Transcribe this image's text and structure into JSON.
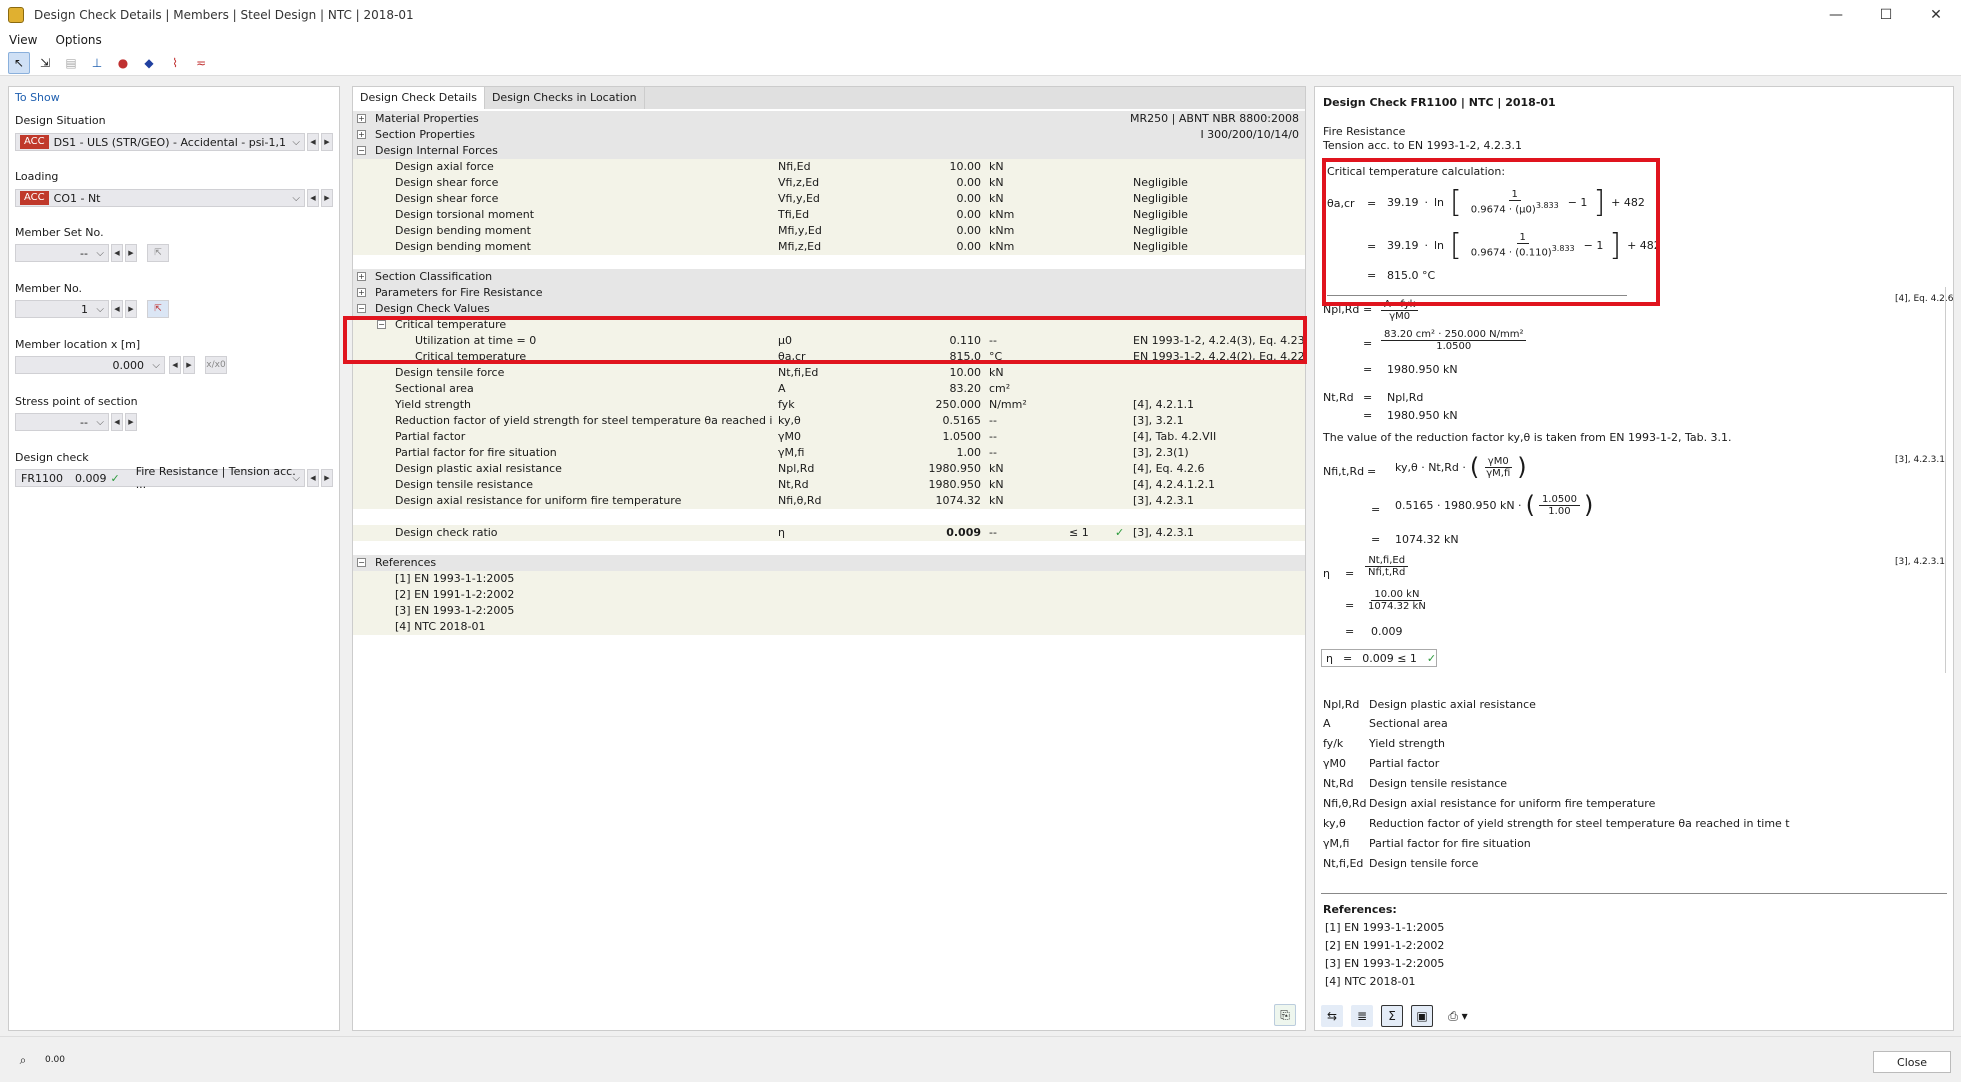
{
  "window": {
    "title": "Design Check Details | Members | Steel Design | NTC | 2018-01"
  },
  "menu": [
    "View",
    "Options"
  ],
  "left": {
    "heading": "To Show",
    "design_situation_label": "Design Situation",
    "design_situation_badge": "ACC",
    "design_situation_value": "DS1 - ULS (STR/GEO) - Accidental - psi-1,1",
    "loading_label": "Loading",
    "loading_badge": "ACC",
    "loading_value": "CO1 - Nt",
    "member_set_label": "Member Set No.",
    "member_set_value": "--",
    "member_no_label": "Member No.",
    "member_no_value": "1",
    "location_label": "Member location x [m]",
    "location_value": "0.000",
    "location_btn": "x/x0",
    "stress_label": "Stress point of section",
    "stress_value": "--",
    "design_check_label": "Design check",
    "design_check_id": "FR1100",
    "design_check_ratio": "0.009",
    "design_check_desc": "Fire Resistance | Tension acc. ..."
  },
  "center": {
    "tabs": [
      "Design Check Details",
      "Design Checks in Location"
    ],
    "sections": {
      "material": {
        "label": "Material Properties",
        "value": "MR250 | ABNT NBR 8800:2008"
      },
      "section": {
        "label": "Section Properties",
        "value": "I 300/200/10/14/0"
      },
      "forces": {
        "label": "Design Internal Forces"
      },
      "classification": {
        "label": "Section Classification"
      },
      "fire_params": {
        "label": "Parameters for Fire Resistance"
      },
      "check_values": {
        "label": "Design Check Values"
      },
      "critical": {
        "label": "Critical temperature"
      },
      "references": {
        "label": "References"
      }
    },
    "forces": [
      {
        "d": "Design axial force",
        "s": "Nfi,Ed",
        "v": "10.00",
        "u": "kN",
        "n": ""
      },
      {
        "d": "Design shear force",
        "s": "Vfi,z,Ed",
        "v": "0.00",
        "u": "kN",
        "n": "Negligible"
      },
      {
        "d": "Design shear force",
        "s": "Vfi,y,Ed",
        "v": "0.00",
        "u": "kN",
        "n": "Negligible"
      },
      {
        "d": "Design torsional moment",
        "s": "Tfi,Ed",
        "v": "0.00",
        "u": "kNm",
        "n": "Negligible"
      },
      {
        "d": "Design bending moment",
        "s": "Mfi,y,Ed",
        "v": "0.00",
        "u": "kNm",
        "n": "Negligible"
      },
      {
        "d": "Design bending moment",
        "s": "Mfi,z,Ed",
        "v": "0.00",
        "u": "kNm",
        "n": "Negligible"
      }
    ],
    "critical_rows": [
      {
        "d": "Utilization at time = 0",
        "s": "μ0",
        "v": "0.110",
        "u": "--",
        "n": "EN 1993-1-2, 4.2.4(3), Eq. 4.23"
      },
      {
        "d": "Critical temperature",
        "s": "θa,cr",
        "v": "815.0",
        "u": "°C",
        "n": "EN 1993-1-2, 4.2.4(2), Eq. 4.22"
      }
    ],
    "check_rows": [
      {
        "d": "Design tensile force",
        "s": "Nt,fi,Ed",
        "v": "10.00",
        "u": "kN",
        "n": ""
      },
      {
        "d": "Sectional area",
        "s": "A",
        "v": "83.20",
        "u": "cm²",
        "n": ""
      },
      {
        "d": "Yield strength",
        "s": "fyk",
        "v": "250.000",
        "u": "N/mm²",
        "n": "[4], 4.2.1.1"
      },
      {
        "d": "Reduction factor of yield strength for steel temperature θa reached in ti...",
        "s": "ky,θ",
        "v": "0.5165",
        "u": "--",
        "n": "[3], 3.2.1"
      },
      {
        "d": "Partial factor",
        "s": "γM0",
        "v": "1.0500",
        "u": "--",
        "n": "[4], Tab. 4.2.VII"
      },
      {
        "d": "Partial factor for fire situation",
        "s": "γM,fi",
        "v": "1.00",
        "u": "--",
        "n": "[3], 2.3(1)"
      },
      {
        "d": "Design plastic axial resistance",
        "s": "Npl,Rd",
        "v": "1980.950",
        "u": "kN",
        "n": "[4], Eq. 4.2.6"
      },
      {
        "d": "Design tensile resistance",
        "s": "Nt,Rd",
        "v": "1980.950",
        "u": "kN",
        "n": "[4], 4.2.4.1.2.1"
      },
      {
        "d": "Design axial resistance for uniform fire temperature",
        "s": "Nfi,θ,Rd",
        "v": "1074.32",
        "u": "kN",
        "n": "[3], 4.2.3.1"
      }
    ],
    "ratio": {
      "d": "Design check ratio",
      "s": "η",
      "v": "0.009",
      "u": "--",
      "c": "≤ 1",
      "n": "[3], 4.2.3.1"
    },
    "references": [
      "[1]  EN 1993-1-1:2005",
      "[2]  EN 1991-1-2:2002",
      "[3]  EN 1993-1-2:2005",
      "[4]  NTC 2018-01"
    ]
  },
  "right": {
    "title": "Design Check FR1100 | NTC | 2018-01",
    "subtitle1": "Fire Resistance",
    "subtitle2": "Tension acc. to EN 1993-1-2, 4.2.3.1",
    "crit_heading": "Critical temperature calculation:",
    "eq_theta": "θa,cr",
    "eq_c1": "39.19",
    "eq_ln": "ln",
    "eq_one": "1",
    "eq_den1": "0.9674 · (μ0)",
    "eq_den2": "0.9674 · (0.110)",
    "eq_exp": "3.833",
    "eq_minus": "− 1",
    "eq_plus": "+ 482",
    "eq_result": "815.0 °C",
    "npl_sym": "Npl,Rd",
    "npl_num": "A · fyk",
    "npl_den": "γM0",
    "npl_num2": "83.20 cm² · 250.000 N/mm²",
    "npl_den2": "1.0500",
    "npl_res": "1980.950 kN",
    "ntrd_sym": "Nt,Rd",
    "ntrd_eq": "Npl,Rd",
    "ntrd_res": "1980.950 kN",
    "ky_text": "The value of the reduction factor ky,θ is taken from EN 1993-1-2, Tab. 3.1.",
    "nfi_sym": "Nfi,t,Rd",
    "nfi_eq": "ky,θ · Nt,Rd ·",
    "nfi_fn": "γM0",
    "nfi_fd": "γM,fi",
    "nfi_eq2": "0.5165 · 1980.950 kN ·",
    "nfi_fn2": "1.0500",
    "nfi_fd2": "1.00",
    "nfi_res": "1074.32 kN",
    "eta_sym": "η",
    "eta_n": "Nt,fi,Ed",
    "eta_d": "Nfi,t,Rd",
    "eta_n2": "10.00 kN",
    "eta_d2": "1074.32 kN",
    "eta_res": "0.009",
    "eta_box": "0.009 ≤ 1",
    "ref_a": "[4], Eq. 4.2.6",
    "ref_b": "[3], 4.2.3.1",
    "ref_c": "[3], 4.2.3.1",
    "legend": [
      {
        "s": "Npl,Rd",
        "t": "Design plastic axial resistance"
      },
      {
        "s": "A",
        "t": "Sectional area"
      },
      {
        "s": "fy/k",
        "t": "Yield strength"
      },
      {
        "s": "γM0",
        "t": "Partial factor"
      },
      {
        "s": "Nt,Rd",
        "t": "Design tensile resistance"
      },
      {
        "s": "Nfi,θ,Rd",
        "t": "Design axial resistance for uniform fire temperature"
      },
      {
        "s": "ky,θ",
        "t": "Reduction factor of yield strength for steel temperature θa reached in time t"
      },
      {
        "s": "γM,fi",
        "t": "Partial factor for fire situation"
      },
      {
        "s": "Nt,fi,Ed",
        "t": "Design tensile force"
      }
    ],
    "refs_heading": "References:",
    "refs": [
      "[1]  EN 1993-1-1:2005",
      "[2]  EN 1991-1-2:2002",
      "[3]  EN 1993-1-2:2005",
      "[4]  NTC 2018-01"
    ]
  },
  "footer": {
    "close": "Close"
  }
}
